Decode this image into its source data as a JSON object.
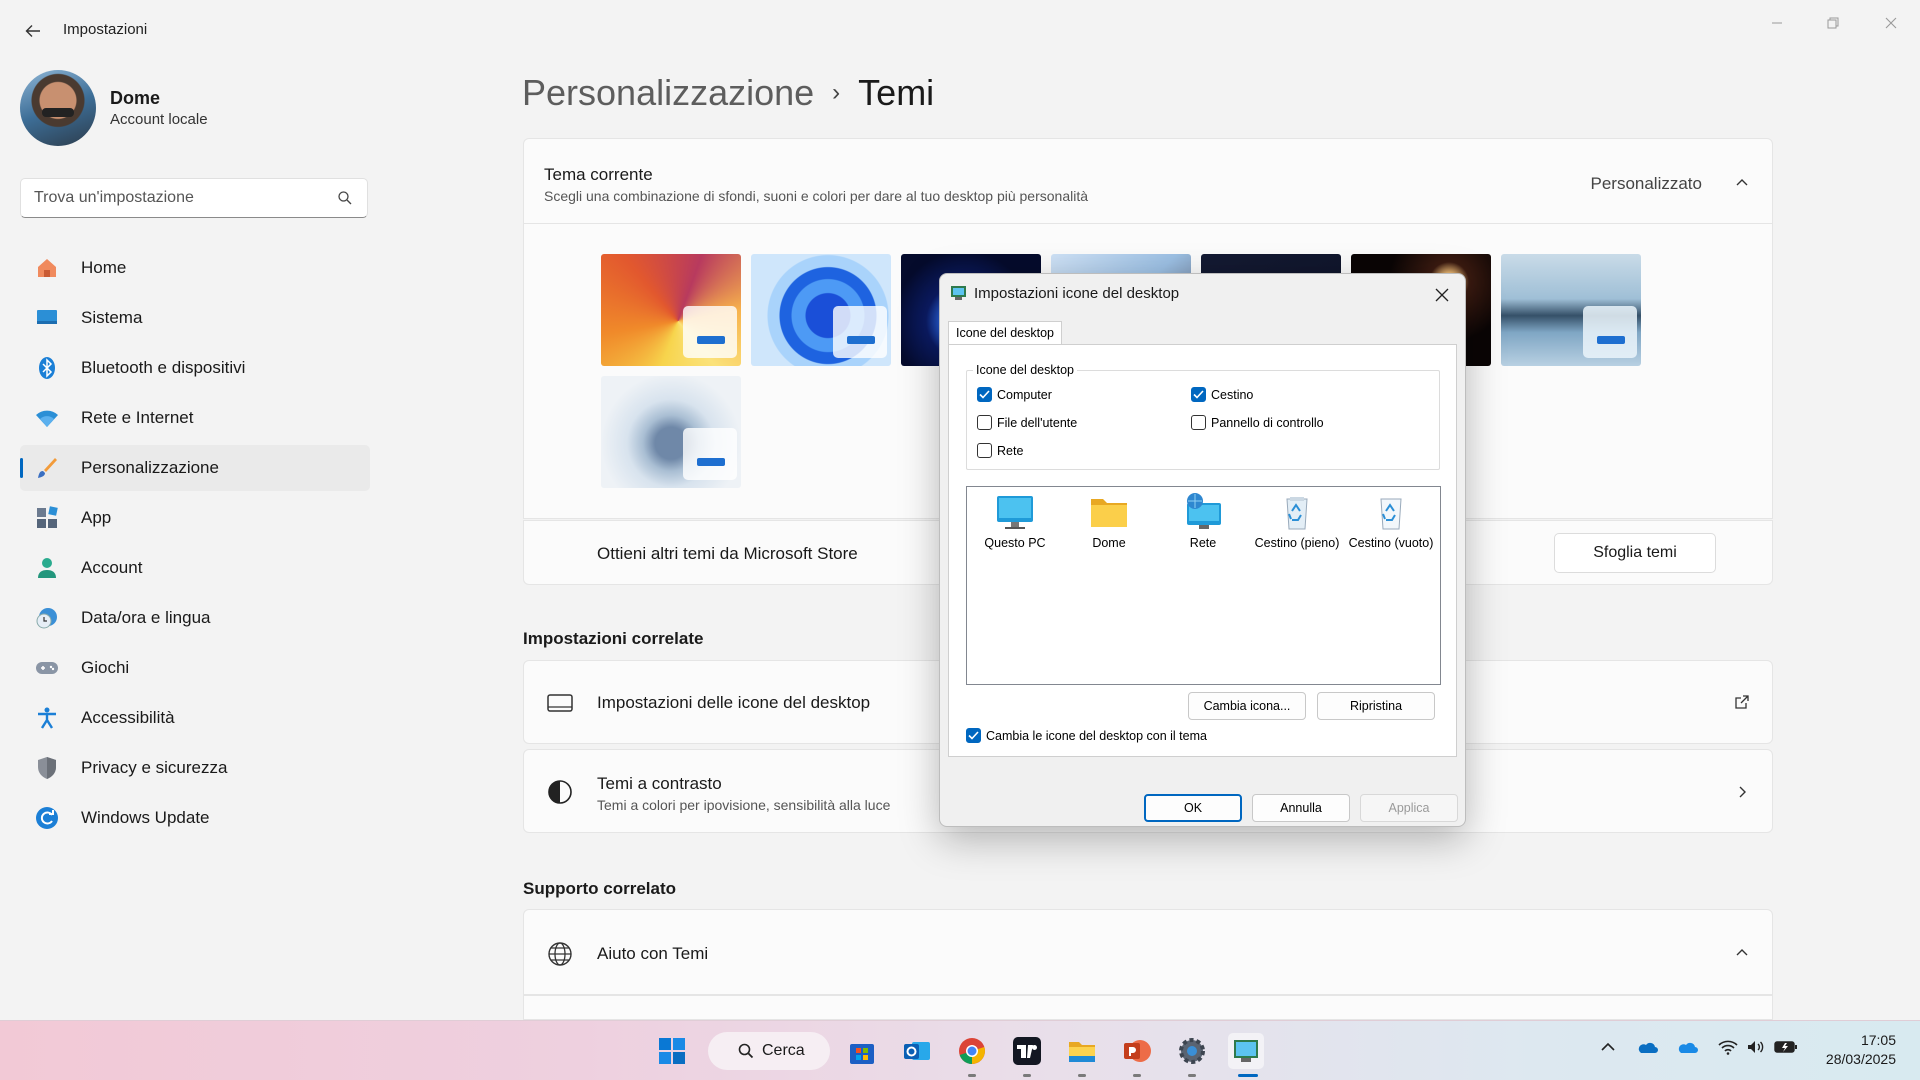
{
  "window": {
    "title": "Impostazioni"
  },
  "user": {
    "name": "Dome",
    "type": "Account locale"
  },
  "search": {
    "placeholder": "Trova un'impostazione"
  },
  "sidebar": {
    "items": [
      {
        "label": "Home",
        "icon": "home-icon"
      },
      {
        "label": "Sistema",
        "icon": "display-icon"
      },
      {
        "label": "Bluetooth e dispositivi",
        "icon": "bluetooth-icon"
      },
      {
        "label": "Rete e Internet",
        "icon": "wifi-icon"
      },
      {
        "label": "Personalizzazione",
        "icon": "brush-icon",
        "active": true
      },
      {
        "label": "App",
        "icon": "apps-icon"
      },
      {
        "label": "Account",
        "icon": "person-icon"
      },
      {
        "label": "Data/ora e lingua",
        "icon": "clock-globe-icon"
      },
      {
        "label": "Giochi",
        "icon": "gamepad-icon"
      },
      {
        "label": "Accessibilità",
        "icon": "accessibility-icon"
      },
      {
        "label": "Privacy e sicurezza",
        "icon": "shield-icon"
      },
      {
        "label": "Windows Update",
        "icon": "refresh-icon"
      }
    ]
  },
  "breadcrumb": {
    "parent": "Personalizzazione",
    "separator": "›",
    "current": "Temi"
  },
  "theme": {
    "title": "Tema corrente",
    "subtitle": "Scegli una combinazione di sfondi, suoni e colori per dare al tuo desktop più personalità",
    "value": "Personalizzato"
  },
  "store": {
    "label": "Ottieni altri temi da Microsoft Store",
    "button": "Sfoglia temi"
  },
  "related": {
    "heading": "Impostazioni correlate",
    "desktop_icons": "Impostazioni delle icone del desktop",
    "contrast_title": "Temi a contrasto",
    "contrast_sub": "Temi a colori per ipovisione, sensibilità alla luce"
  },
  "support": {
    "heading": "Supporto correlato",
    "help": "Aiuto con Temi"
  },
  "dialog": {
    "title": "Impostazioni icone del desktop",
    "tab": "Icone del desktop",
    "group_label": "Icone del desktop",
    "checkboxes": [
      {
        "label": "Computer",
        "checked": true
      },
      {
        "label": "Cestino",
        "checked": true
      },
      {
        "label": "File dell'utente",
        "checked": false
      },
      {
        "label": "Pannello di controllo",
        "checked": false
      },
      {
        "label": "Rete",
        "checked": false
      }
    ],
    "icons": [
      "Questo PC",
      "Dome",
      "Rete",
      "Cestino (pieno)",
      "Cestino (vuoto)"
    ],
    "change_icon": "Cambia icona...",
    "restore": "Ripristina",
    "theme_checkbox": "Cambia le icone del desktop con il tema",
    "theme_checkbox_checked": true,
    "ok": "OK",
    "cancel": "Annulla",
    "apply": "Applica"
  },
  "taskbar": {
    "search_label": "Cerca",
    "time": "17:05",
    "date": "28/03/2025"
  },
  "colors": {
    "accent": "#0067c0",
    "background": "#f3f3f3"
  }
}
